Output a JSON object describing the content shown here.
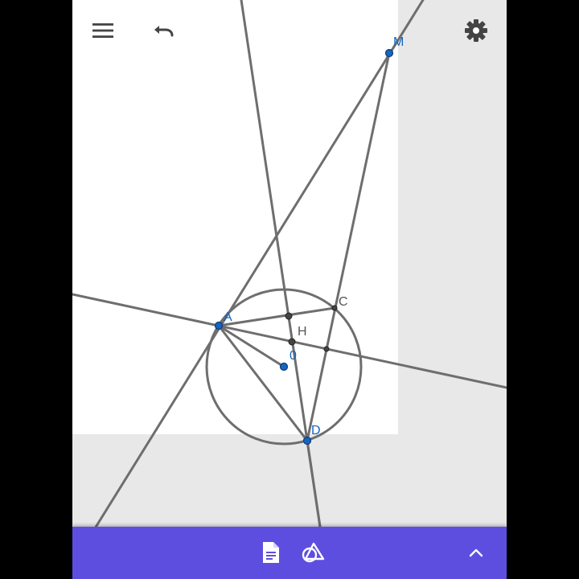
{
  "toolbar": {
    "menu_icon": "menu-icon",
    "undo_icon": "undo-icon",
    "settings_icon": "gear-icon"
  },
  "bottom_bar": {
    "algebra_icon": "document-icon",
    "tools_icon": "geometry-tools-icon",
    "expand_icon": "chevron-up-icon",
    "color": "#5e4ee0"
  },
  "points": {
    "M": "M",
    "A": "A",
    "C": "C",
    "H": "H",
    "O": "0",
    "D": "D"
  },
  "colors": {
    "point_fill": "#1565c0",
    "label_blue": "#1565c0",
    "label_gray": "#555555",
    "line": "#6e6e6e"
  }
}
